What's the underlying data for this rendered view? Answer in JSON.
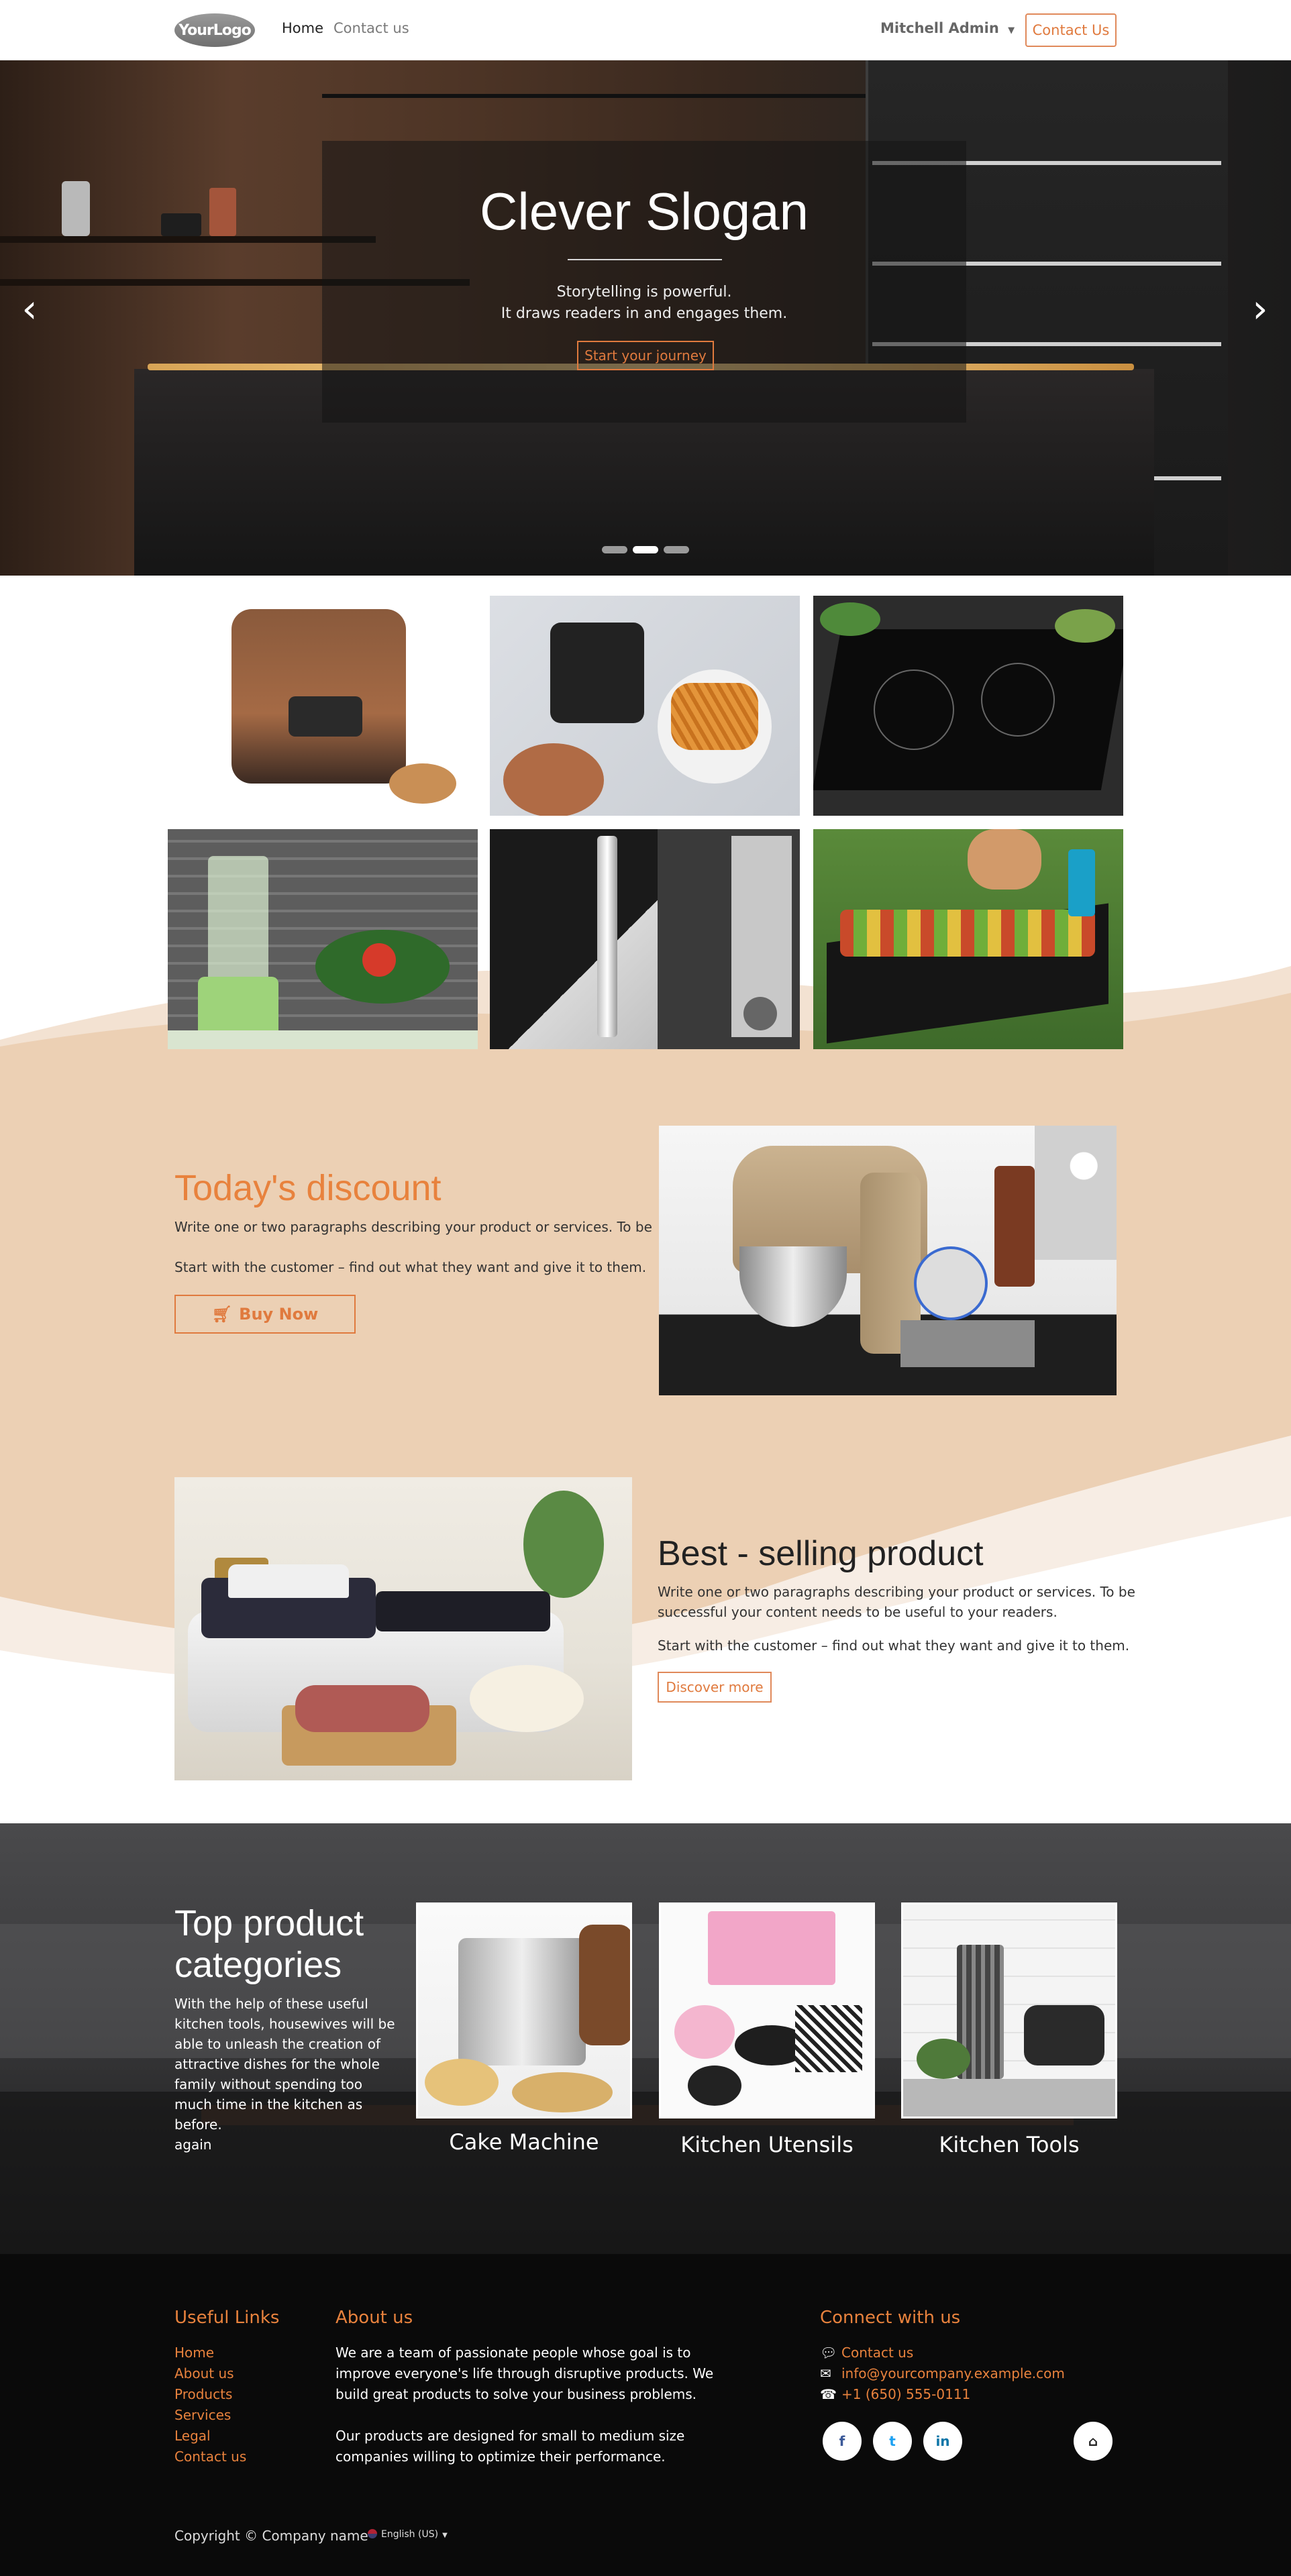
{
  "navbar": {
    "logo_text": "YourLogo",
    "links": [
      "Home",
      "Contact us"
    ],
    "user": "Mitchell Admin",
    "cta": "Contact Us"
  },
  "hero": {
    "title": "Clever Slogan",
    "subtitle_line1": "Storytelling is powerful.",
    "subtitle_line2": "It draws readers in and engages them.",
    "button": "Start your journey",
    "active_slide": 2,
    "slide_count": 3
  },
  "gallery": {
    "items": [
      "rice-cooker",
      "air-fryer",
      "induction-cooktop",
      "blender",
      "microwave",
      "bbq-grill"
    ]
  },
  "discount": {
    "title": "Today's discount",
    "para1": "Write one or two paragraphs describing your product or services. To be",
    "para2": "Start with the customer – find out what they want and give it to them.",
    "button": "Buy Now"
  },
  "best": {
    "title": "Best - selling product",
    "para1_line1": "Write one or two paragraphs describing your product or services. To be",
    "para1_line2": "successful your content needs to be useful to your readers.",
    "para2": "Start with the customer – find out what they want and give it to them.",
    "button": "Discover more"
  },
  "categories": {
    "title_line1": "Top product",
    "title_line2": "categories",
    "description": "With the help of these useful kitchen tools, housewives will be able to unleash the creation of attractive dishes for the whole family without spending too much time in the kitchen as before.",
    "link": "again",
    "items": [
      "Cake Machine",
      "Kitchen Utensils",
      "Kitchen Tools"
    ]
  },
  "footer": {
    "useful_links_title": "Useful Links",
    "useful_links": [
      "Home",
      "About us",
      "Products",
      "Services",
      "Legal",
      "Contact us"
    ],
    "about_title": "About us",
    "about_para1_line1": "We are a team of passionate people whose goal is to",
    "about_para1_line2": "improve everyone's life through disruptive products. We",
    "about_para1_line3": "build great products to solve your business problems.",
    "about_para2_line1": "Our products are designed for small to medium size",
    "about_para2_line2": "companies willing to optimize their performance.",
    "connect_title": "Connect with us",
    "contact_link": "Contact us",
    "email": "info@yourcompany.example.com",
    "phone": "+1 (650) 555-0111",
    "copyright": "Copyright © Company name",
    "language": "English (US)"
  },
  "colors": {
    "accent": "#e07a3e",
    "peach": "#ecd0b4",
    "footer_bg": "#0a0a0a"
  }
}
